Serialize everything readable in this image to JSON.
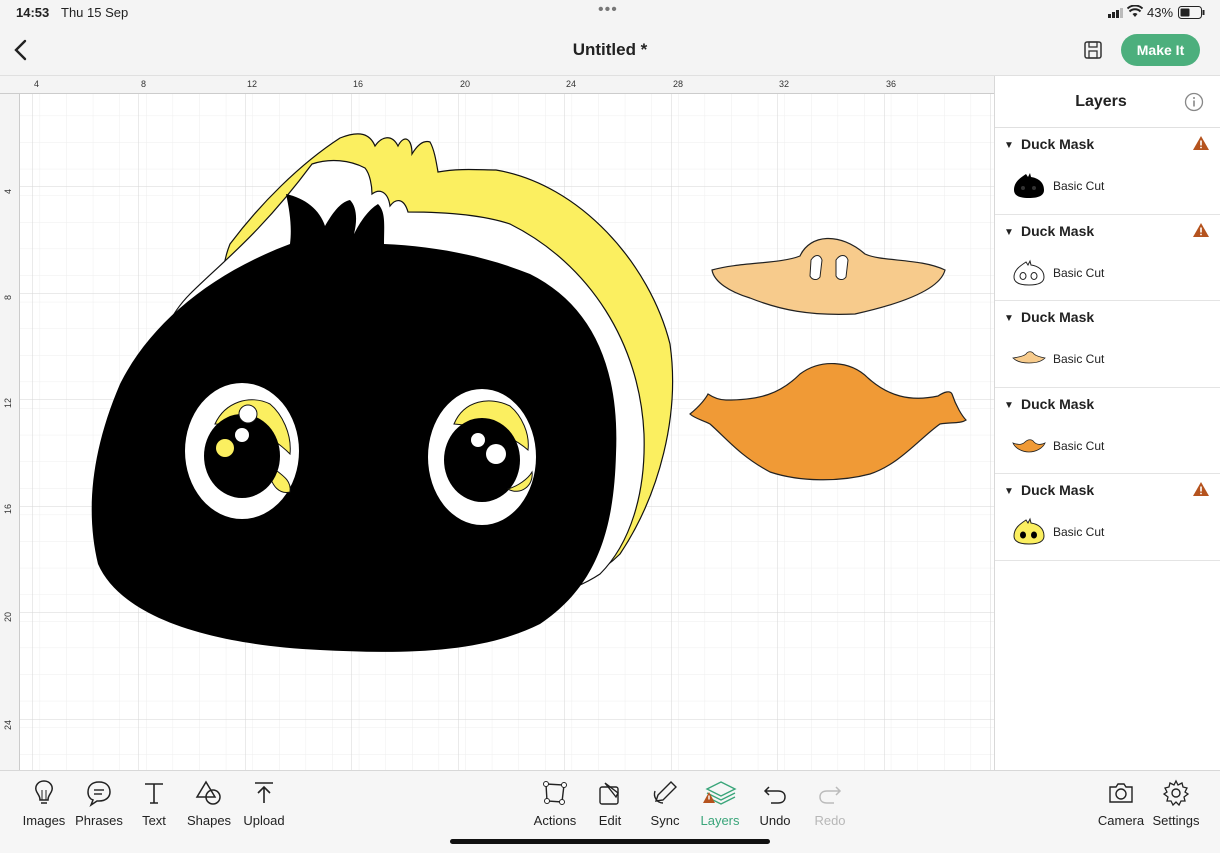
{
  "status": {
    "time": "14:53",
    "date": "Thu 15 Sep",
    "battery": "43%"
  },
  "header": {
    "title": "Untitled *",
    "make_it": "Make It"
  },
  "ruler": {
    "top": [
      "4",
      "8",
      "12",
      "16",
      "20",
      "24",
      "28",
      "32",
      "36"
    ],
    "left": [
      "4",
      "8",
      "12",
      "16",
      "20",
      "24"
    ]
  },
  "layers": {
    "title": "Layers",
    "groups": [
      {
        "name": "Duck Mask",
        "item": "Basic Cut",
        "warning": true,
        "thumb": "black-face"
      },
      {
        "name": "Duck Mask",
        "item": "Basic Cut",
        "warning": true,
        "thumb": "white-face"
      },
      {
        "name": "Duck Mask",
        "item": "Basic Cut",
        "warning": false,
        "thumb": "light-beak"
      },
      {
        "name": "Duck Mask",
        "item": "Basic Cut",
        "warning": false,
        "thumb": "orange-beak"
      },
      {
        "name": "Duck Mask",
        "item": "Basic Cut",
        "warning": true,
        "thumb": "yellow-face"
      }
    ]
  },
  "toolbar": {
    "images": "Images",
    "phrases": "Phrases",
    "text": "Text",
    "shapes": "Shapes",
    "upload": "Upload",
    "actions": "Actions",
    "edit": "Edit",
    "sync": "Sync",
    "layers": "Layers",
    "undo": "Undo",
    "redo": "Redo",
    "camera": "Camera",
    "settings": "Settings"
  },
  "colors": {
    "accent": "#4caf7d",
    "warning": "#b5531e",
    "yellow": "#fbef60",
    "beak_light": "#f7cb8c",
    "beak_orange": "#f09a36"
  }
}
